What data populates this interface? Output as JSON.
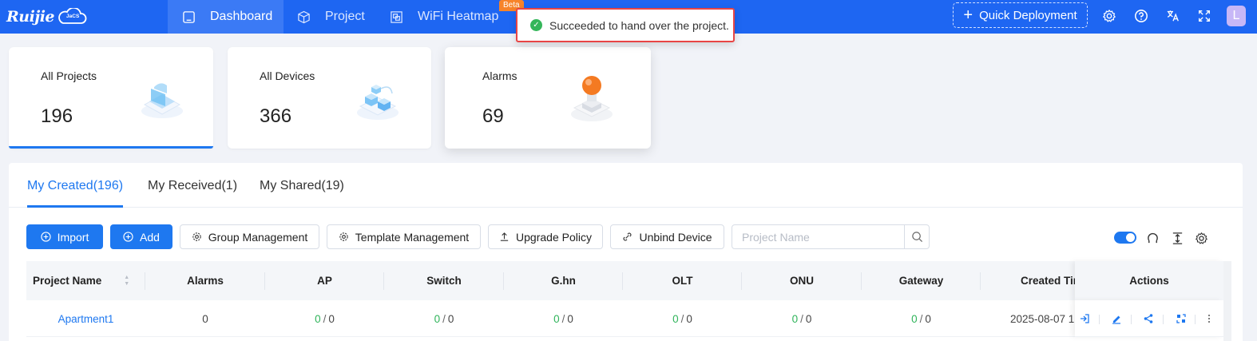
{
  "header": {
    "logo_text": "Ruijie",
    "logo_sub": "JaCS",
    "nav": [
      {
        "label": "Dashboard",
        "icon": "dashboard-icon",
        "active": true
      },
      {
        "label": "Project",
        "icon": "cube-icon",
        "active": false
      },
      {
        "label": "WiFi Heatmap",
        "icon": "heatmap-icon",
        "active": false
      }
    ],
    "beta_badge": "Beta",
    "quick_deployment": "Quick Deployment",
    "user_initial": "L",
    "accent_color": "#1e66f2"
  },
  "toast": {
    "message": "Succeeded to hand over the project.",
    "status_color": "#35b65a"
  },
  "stats": [
    {
      "title": "All Projects",
      "value": "196"
    },
    {
      "title": "All Devices",
      "value": "366"
    },
    {
      "title": "Alarms",
      "value": "69"
    }
  ],
  "tabs": [
    {
      "label": "My Created(196)",
      "active": true
    },
    {
      "label": "My Received(1)",
      "active": false
    },
    {
      "label": "My Shared(19)",
      "active": false
    }
  ],
  "toolbar": {
    "import": "Import",
    "add": "Add",
    "group_management": "Group Management",
    "template_management": "Template Management",
    "upgrade_policy": "Upgrade Policy",
    "unbind_device": "Unbind Device",
    "search_placeholder": "Project Name"
  },
  "table": {
    "columns": [
      "Project Name",
      "Alarms",
      "AP",
      "Switch",
      "G.hn",
      "OLT",
      "ONU",
      "Gateway",
      "Created Tir",
      "Actions"
    ],
    "rows": [
      {
        "project_name": "Apartment1",
        "alarms": "0",
        "ap": {
          "online": "0",
          "total": "0"
        },
        "switch": {
          "online": "0",
          "total": "0"
        },
        "ghn": {
          "online": "0",
          "total": "0"
        },
        "olt": {
          "online": "0",
          "total": "0"
        },
        "onu": {
          "online": "0",
          "total": "0"
        },
        "gateway": {
          "online": "0",
          "total": "0"
        },
        "created_time": "2025-08-07 1"
      }
    ]
  }
}
